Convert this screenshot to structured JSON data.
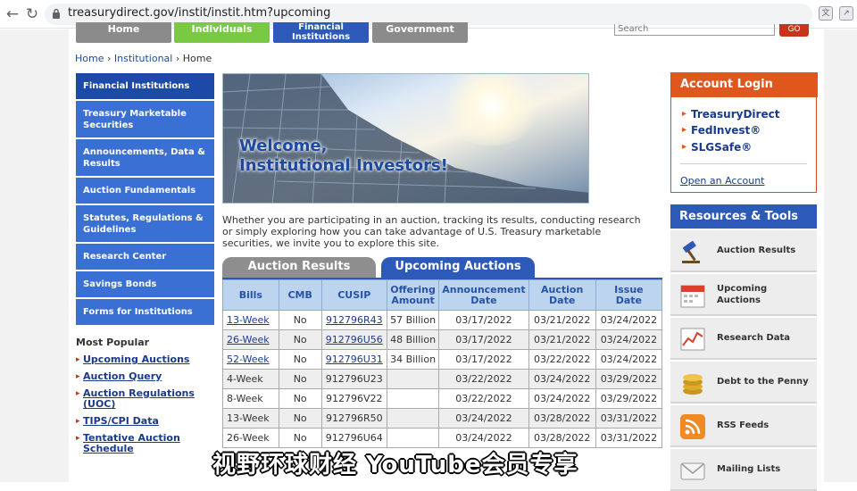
{
  "browser": {
    "url": "treasurydirect.gov/instit/instit.htm?upcoming"
  },
  "top_tabs": [
    {
      "label": "Home",
      "color": "#8b8b8b"
    },
    {
      "label": "Individuals",
      "color": "#7ac943"
    },
    {
      "label": "Financial\nInstitutions",
      "color": "#2d59b9"
    },
    {
      "label": "Government",
      "color": "#8b8b8b"
    }
  ],
  "search": {
    "placeholder": "Search",
    "go_label": "GO"
  },
  "breadcrumb": {
    "home": "Home",
    "sep": "›",
    "institutional": "Institutional",
    "current": "Home"
  },
  "left_nav": [
    "Financial Institutions",
    "Treasury Marketable Securities",
    "Announcements, Data & Results",
    "Auction Fundamentals",
    "Statutes, Regulations & Guidelines",
    "Research Center",
    "Savings Bonds",
    "Forms for Institutions"
  ],
  "most_popular": {
    "title": "Most Popular",
    "items": [
      "Upcoming Auctions",
      "Auction Query",
      "Auction Regulations (UOC)",
      "TIPS/CPI Data",
      "Tentative Auction Schedule"
    ]
  },
  "hero": {
    "line1": "Welcome,",
    "line2": "Institutional Investors!"
  },
  "intro": "Whether you are participating in an auction, tracking its results, conducting research or simply exploring how you can take advantage of U.S. Treasury marketable securities, we invite you to explore this site.",
  "auction_tabs": {
    "results": "Auction Results",
    "upcoming": "Upcoming Auctions"
  },
  "table": {
    "headers": [
      "Bills",
      "CMB",
      "CUSIP",
      "Offering\nAmount",
      "Announcement\nDate",
      "Auction\nDate",
      "Issue\nDate"
    ],
    "rows": [
      [
        "13-Week",
        "No",
        "912796R43",
        "57 Billion",
        "03/17/2022",
        "03/21/2022",
        "03/24/2022"
      ],
      [
        "26-Week",
        "No",
        "912796U56",
        "48 Billion",
        "03/17/2022",
        "03/21/2022",
        "03/24/2022"
      ],
      [
        "52-Week",
        "No",
        "912796U31",
        "34 Billion",
        "03/17/2022",
        "03/22/2022",
        "03/24/2022"
      ],
      [
        "4-Week",
        "No",
        "912796U23",
        "",
        "03/22/2022",
        "03/24/2022",
        "03/29/2022"
      ],
      [
        "8-Week",
        "No",
        "912796V22",
        "",
        "03/22/2022",
        "03/24/2022",
        "03/29/2022"
      ],
      [
        "13-Week",
        "No",
        "912796R50",
        "",
        "03/24/2022",
        "03/28/2022",
        "03/31/2022"
      ],
      [
        "26-Week",
        "No",
        "912796U64",
        "",
        "03/24/2022",
        "03/28/2022",
        "03/31/2022"
      ]
    ]
  },
  "account_login": {
    "title": "Account Login",
    "links": [
      "TreasuryDirect",
      "FedInvest®",
      "SLGSafe®"
    ],
    "open": "Open an Account"
  },
  "resources": {
    "title": "Resources & Tools",
    "items": [
      "Auction Results",
      "Upcoming\nAuctions",
      "Research Data",
      "Debt to the Penny",
      "RSS Feeds",
      "Mailing Lists"
    ]
  },
  "subtitle_overlay": "视野环球财经 YouTube会员专享",
  "colors": {
    "brand_blue": "#2d59b9",
    "nav_blue": "#3a6fd3",
    "orange": "#e0571e",
    "green": "#7ac943"
  }
}
